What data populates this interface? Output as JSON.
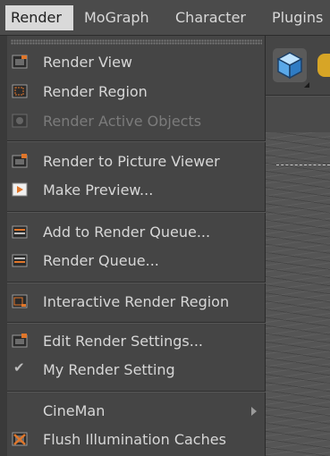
{
  "menubar": {
    "items": [
      {
        "label": "Render"
      },
      {
        "label": "MoGraph"
      },
      {
        "label": "Character"
      },
      {
        "label": "Plugins"
      }
    ]
  },
  "menu": {
    "items": [
      {
        "label": "Render View",
        "icon": "render-view-icon"
      },
      {
        "label": "Render Region",
        "icon": "render-region-icon"
      },
      {
        "label": "Render Active Objects",
        "icon": "render-active-objects-icon"
      },
      {
        "label": "Render to Picture Viewer",
        "icon": "picture-viewer-icon"
      },
      {
        "label": "Make Preview...",
        "icon": "make-preview-icon"
      },
      {
        "label": "Add to Render Queue...",
        "icon": "add-render-queue-icon"
      },
      {
        "label": "Render Queue...",
        "icon": "render-queue-icon"
      },
      {
        "label": "Interactive Render Region",
        "icon": "interactive-render-region-icon"
      },
      {
        "label": "Edit Render Settings...",
        "icon": "render-settings-icon"
      },
      {
        "label": "My Render Setting",
        "icon": "checkmark-icon"
      },
      {
        "label": "CineMan",
        "icon": "submenu-arrow-icon"
      },
      {
        "label": "Flush Illumination Caches",
        "icon": "flush-caches-icon"
      }
    ]
  },
  "colors": {
    "menu_bg": "#454545",
    "menubar_active": "#d9d9d9",
    "accent_orange": "#e0762a",
    "disabled_text": "#7b7b7b"
  }
}
